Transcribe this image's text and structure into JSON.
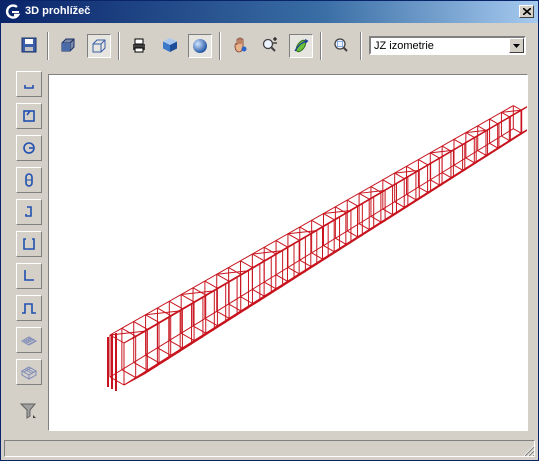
{
  "window": {
    "title": "3D prohlížeč"
  },
  "toolbar": {
    "buttons": [
      {
        "name": "save-icon",
        "pressed": false
      },
      {
        "name": "solid-box-view-icon",
        "pressed": false
      },
      {
        "name": "wireframe-box-view-icon",
        "pressed": true
      },
      {
        "name": "print-icon",
        "pressed": false
      },
      {
        "name": "shaded-cube-icon",
        "pressed": false
      },
      {
        "name": "sphere-render-icon",
        "pressed": true
      },
      {
        "name": "pan-hand-icon",
        "pressed": false
      },
      {
        "name": "zoom-plus-minus-icon",
        "pressed": false
      },
      {
        "name": "orbit-icon",
        "pressed": true
      },
      {
        "name": "zoom-extents-icon",
        "pressed": false
      }
    ],
    "view_select": {
      "value": "JZ izometrie"
    }
  },
  "sidebar": {
    "items": [
      {
        "name": "rebar-shape-u-icon"
      },
      {
        "name": "rebar-shape-square-hook-icon"
      },
      {
        "name": "rebar-shape-circle-hook-icon"
      },
      {
        "name": "rebar-shape-closed-loop-icon"
      },
      {
        "name": "rebar-shape-j-hook-icon"
      },
      {
        "name": "rebar-shape-open-stirrup-icon"
      },
      {
        "name": "rebar-shape-l-icon"
      },
      {
        "name": "rebar-shape-wave-icon"
      },
      {
        "name": "mesh-flat-icon"
      },
      {
        "name": "mesh-3d-icon"
      },
      {
        "name": "filter-icon"
      }
    ]
  },
  "viewport": {
    "model_color": "#c8141e",
    "background": "#ffffff"
  },
  "status": {
    "text": ""
  }
}
